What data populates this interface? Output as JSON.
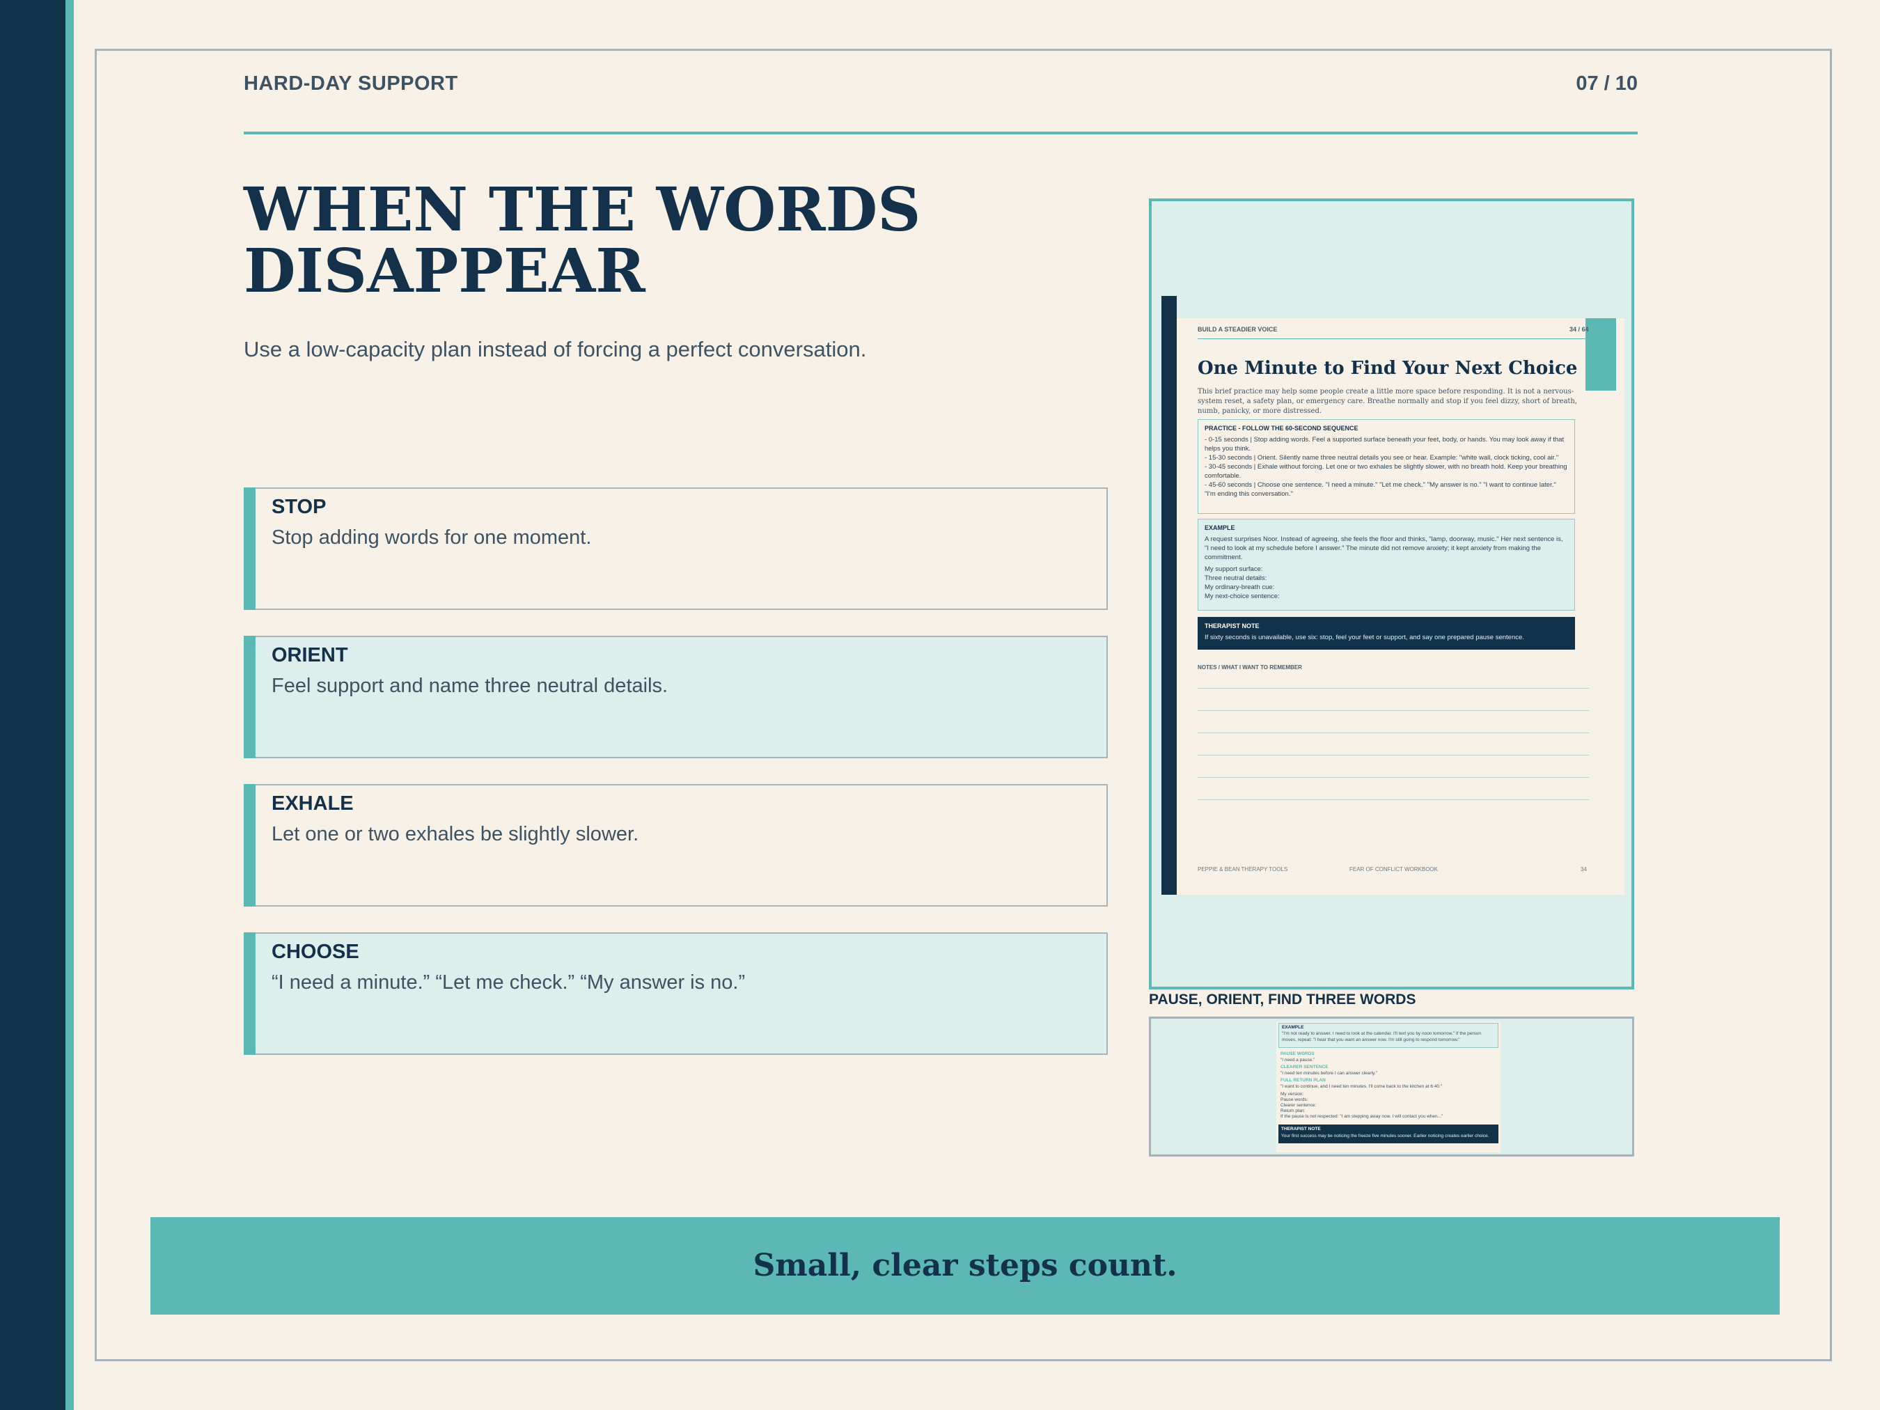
{
  "header": {
    "kicker": "HARD-DAY SUPPORT",
    "page_number": "07 / 10"
  },
  "title": {
    "line1": "WHEN THE WORDS",
    "line2": "DISAPPEAR"
  },
  "subtitle": "Use a low-capacity plan instead of forcing a perfect conversation.",
  "steps": [
    {
      "label": "STOP",
      "text": "Stop adding words for one moment."
    },
    {
      "label": "ORIENT",
      "text": "Feel support and name three neutral details."
    },
    {
      "label": "EXHALE",
      "text": "Let one or two exhales be slightly slower."
    },
    {
      "label": "CHOOSE",
      "text": "“I need a minute.” “Let me check.” “My answer is no.”"
    }
  ],
  "preview": {
    "header_left": "BUILD A STEADIER VOICE",
    "header_right": "34 / 64",
    "title": "One Minute to Find Your Next Choice",
    "intro": "This brief practice may help some people create a little more space before responding. It is not a nervous-system reset, a safety plan, or emergency care. Breathe normally and stop if you feel dizzy, short of breath, numb, panicky, or more distressed.",
    "practice_title": "PRACTICE - FOLLOW THE 60-SECOND SEQUENCE",
    "practice_lines": [
      "- 0-15 seconds | Stop adding words. Feel a supported surface beneath your feet, body, or hands. You may look away if that helps you think.",
      "- 15-30 seconds | Orient. Silently name three neutral details you see or hear. Example: \"white wall, clock ticking, cool air.\"",
      "- 30-45 seconds | Exhale without forcing. Let one or two exhales be slightly slower, with no breath hold. Keep your breathing comfortable.",
      "- 45-60 seconds | Choose one sentence. \"I need a minute.\" \"Let me check.\" \"My answer is no.\" \"I want to continue later.\" \"I'm ending this conversation.\""
    ],
    "example_title": "EXAMPLE",
    "example_text": "A request surprises Noor. Instead of agreeing, she feels the floor and thinks, \"lamp, doorway, music.\" Her next sentence is, \"I need to look at my schedule before I answer.\" The minute did not remove anxiety; it kept anxiety from making the commitment.",
    "example_fields": [
      "My support surface:",
      "Three neutral details:",
      "My ordinary-breath cue:",
      "My next-choice sentence:"
    ],
    "note_title": "THERAPIST NOTE",
    "note_text": "If sixty seconds is unavailable, use six: stop, feel your feet or support, and say one prepared pause sentence.",
    "notes_label": "NOTES / WHAT I WANT TO REMEMBER",
    "footer_left": "PEPPIE & BEAN THERAPY TOOLS",
    "footer_center": "FEAR OF CONFLICT WORKBOOK",
    "footer_right": "34"
  },
  "preview_caption": "PAUSE, ORIENT, FIND THREE WORDS",
  "preview2": {
    "example_title": "EXAMPLE",
    "example_text": "\"I'm not ready to answer. I need to look at the calendar. I'll text you by noon tomorrow.\" If the person moves, repeat: \"I hear that you want an answer now. I'm still going to respond tomorrow.\"",
    "pause_label": "PAUSE WORDS",
    "pause_text": "\"I need a pause.\"",
    "clearer_label": "CLEARER SENTENCE",
    "clearer_text": "\"I need ten minutes before I can answer clearly.\"",
    "return_label": "FULL RETURN PLAN",
    "return_text": "\"I want to continue, and I need ten minutes. I'll come back to the kitchen at 6:40.\"",
    "fields": [
      "My version:",
      "Pause words:",
      "Clearer sentence:",
      "Return plan:",
      "If the pause is not respected: \"I am stepping away now. I will contact you when...\""
    ],
    "note_title": "THERAPIST NOTE",
    "note_text": "Your first success may be noticing the freeze five minutes sooner. Earlier noticing creates earlier choice."
  },
  "banner": "Small, clear steps count."
}
